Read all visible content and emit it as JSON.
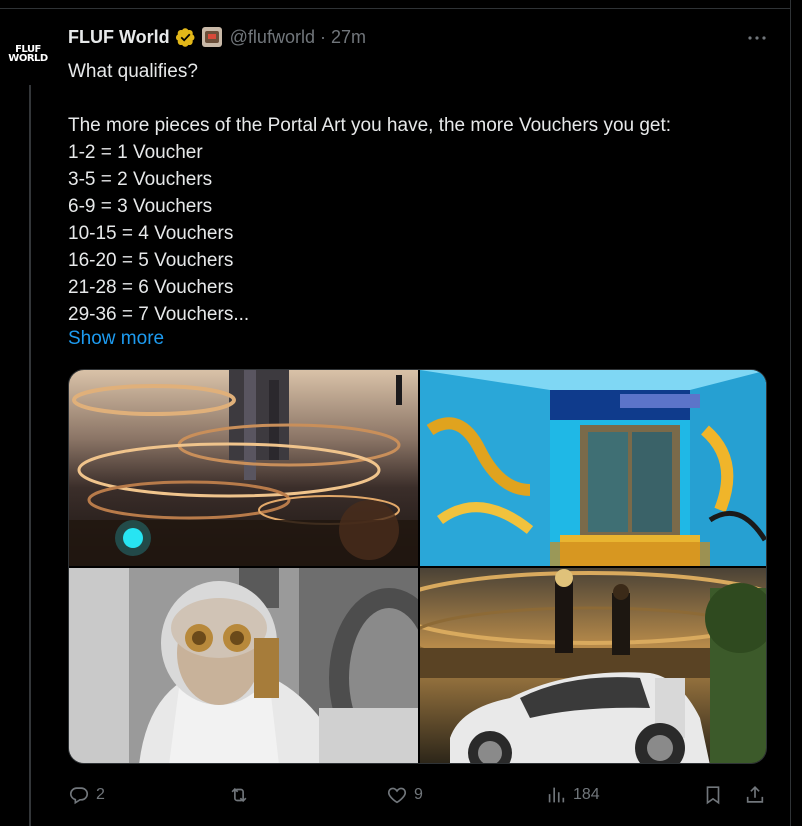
{
  "tweet": {
    "author": {
      "name": "FLUF World",
      "handle": "@flufworld",
      "avatar_lines": [
        "FLUF",
        "WORLD"
      ],
      "verified": true
    },
    "separator": "·",
    "time": "27m",
    "text_lines": [
      "What qualifies?",
      "",
      "The more pieces of the Portal Art you have, the more Vouchers you get:",
      "1-2 = 1 Voucher",
      "3-5 = 2 Vouchers",
      "6-9 = 3 Vouchers",
      "10-15 = 4 Vouchers",
      "16-20 = 5 Vouchers",
      "21-28 = 6 Vouchers",
      "29-36 = 7 Vouchers..."
    ],
    "show_more_label": "Show more",
    "media": [
      {
        "name": "Sci-fi landscape with swirling golden rings"
      },
      {
        "name": "Graffiti-covered portal doorway"
      },
      {
        "name": "Figure in white space suit with golden goggles"
      },
      {
        "name": "White futuristic car with figures on a balcony"
      }
    ],
    "actions": {
      "replies": "2",
      "retweets": "",
      "likes": "9",
      "views": "184"
    }
  },
  "colors": {
    "background": "#000000",
    "text": "#e7e9ea",
    "muted": "#71767b",
    "link": "#1d9bf0",
    "verified_gold": "#e2b719",
    "border": "#2f3336"
  },
  "icons": [
    "verified-badge-icon",
    "more-icon",
    "reply-icon",
    "retweet-icon",
    "like-icon",
    "views-icon",
    "bookmark-icon",
    "share-icon"
  ]
}
